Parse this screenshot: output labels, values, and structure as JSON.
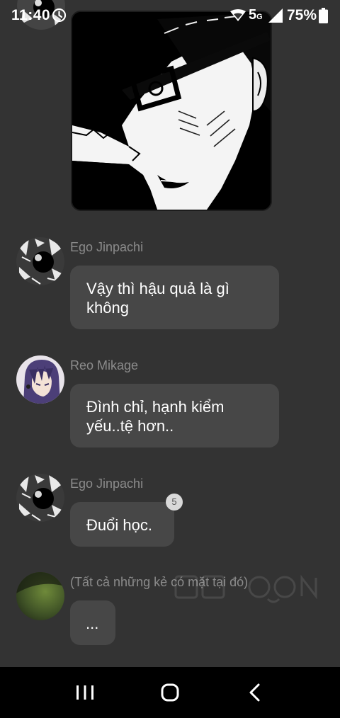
{
  "status_bar": {
    "time": "11:40",
    "network": "5",
    "network_sub": "G",
    "battery": "75%",
    "icons": [
      "alarm-icon",
      "wifi-icon",
      "signal-icon",
      "battery-icon"
    ]
  },
  "media": {
    "type": "manga-panel-image",
    "icon": "image-icon"
  },
  "messages": [
    {
      "sender": "Ego Jinpachi",
      "lines": [
        "Vậy thì hậu quả là gì",
        "không"
      ],
      "avatar": "avatar-ego"
    },
    {
      "sender": "Reo Mikage",
      "lines": [
        "Đình chỉ, hạnh kiểm",
        "yếu..tệ hơn.."
      ],
      "avatar": "avatar-reo"
    },
    {
      "sender": "Ego Jinpachi",
      "lines": [
        "Đuổi học."
      ],
      "reaction_count": "5",
      "avatar": "avatar-ego"
    },
    {
      "sender": "(Tất cả những kẻ có mặt tại đó)",
      "lines": [
        "..."
      ],
      "avatar": "avatar-group"
    }
  ],
  "nav_bar": {
    "buttons": [
      "recents-icon",
      "home-icon",
      "back-icon"
    ]
  },
  "colors": {
    "background": "#333333",
    "bubble": "#474747",
    "sender_name": "#8b8b8b",
    "text": "#ffffff",
    "nav_background": "#000000"
  }
}
